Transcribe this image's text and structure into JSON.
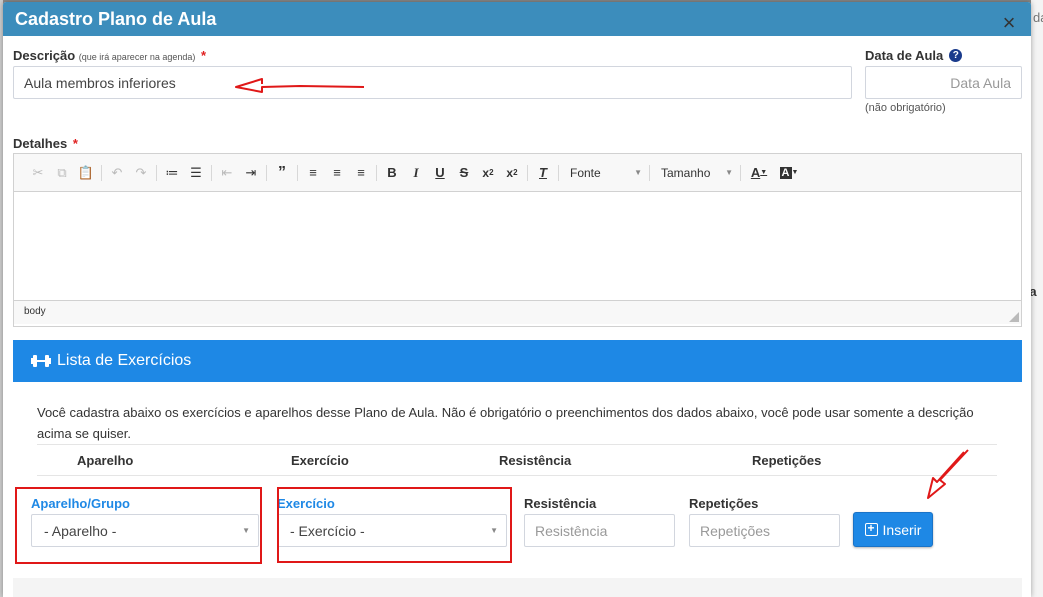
{
  "background": {
    "snippet_top": "da",
    "snippet_mid": "ta"
  },
  "modal": {
    "title": "Cadastro Plano de Aula",
    "close_glyph": "×"
  },
  "descricao": {
    "label": "Descrição",
    "hint": "(que irá aparecer na agenda)",
    "required_mark": "*",
    "value": "Aula membros inferiores"
  },
  "data_aula": {
    "label": "Data de Aula",
    "placeholder": "Data Aula",
    "note": "(não obrigatório)"
  },
  "detalhes": {
    "label": "Detalhes",
    "required_mark": "*"
  },
  "editor": {
    "font_label": "Fonte",
    "size_label": "Tamanho",
    "footer_path": "body",
    "tools": [
      "cut-icon",
      "copy-icon",
      "paste-icon",
      "undo-icon",
      "redo-icon",
      "numbered-list-icon",
      "bullet-list-icon",
      "outdent-icon",
      "indent-icon",
      "blockquote-icon",
      "align-left-icon",
      "align-center-icon",
      "align-right-icon",
      "bold-icon",
      "italic-icon",
      "underline-icon",
      "strikethrough-icon",
      "subscript-icon",
      "superscript-icon",
      "remove-format-icon",
      "text-color-icon",
      "background-color-icon"
    ]
  },
  "exercicios": {
    "header": "Lista de Exercícios",
    "description": "Você cadastra abaixo os exercícios e aparelhos desse Plano de Aula. Não é obrigatório o preenchimentos dos dados abaixo, você pode usar somente a descrição acima se quiser.",
    "columns": [
      "Aparelho",
      "Exercício",
      "Resistência",
      "Repetições"
    ],
    "form": {
      "aparelho_label": "Aparelho/Grupo",
      "aparelho_selected": "- Aparelho -",
      "exercicio_label": "Exercício",
      "exercicio_selected": "- Exercício -",
      "resistencia_label": "Resistência",
      "resistencia_placeholder": "Resistência",
      "repeticoes_label": "Repetições",
      "repeticoes_placeholder": "Repetições",
      "insert_label": "Inserir"
    }
  },
  "colors": {
    "header_blue": "#3c8dbc",
    "box_blue": "#1e88e5",
    "annotation_red": "#e01818"
  }
}
